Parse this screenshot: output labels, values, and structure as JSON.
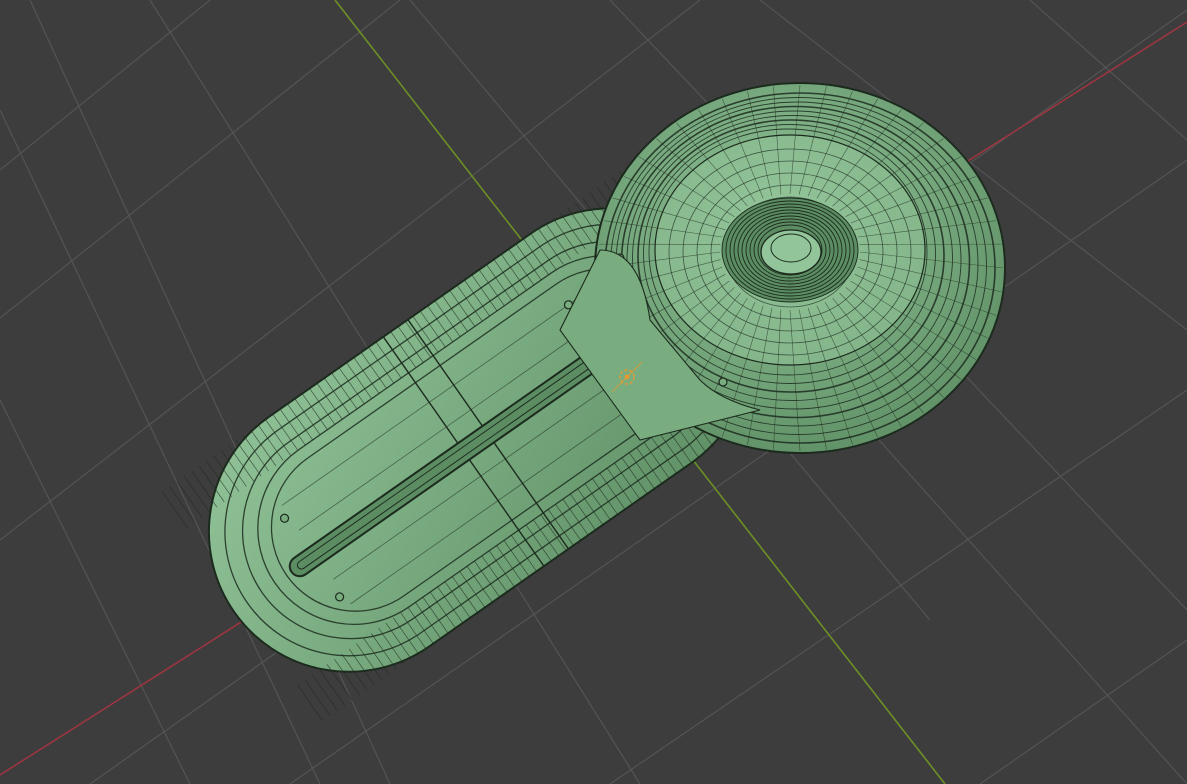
{
  "viewport": {
    "view": "3d-viewport",
    "shading_mode": "solid",
    "overlay": "wireframe"
  },
  "colors": {
    "background": "#3d3d3d",
    "grid": "#545454",
    "x_axis": "#9c3540",
    "y_axis": "#6e8f26",
    "mesh_fill": "#79ad7f",
    "mesh_highlight": "#93c59a",
    "mesh_shadow": "#5c8d62",
    "wire": "#1c2b1e",
    "origin": "#e59a32"
  },
  "scene": {
    "object": "paddle-mesh",
    "parts": [
      "round-cup",
      "handle-tray",
      "center-slot",
      "cup-hub"
    ],
    "selected_object_origin": "origin-marker"
  }
}
